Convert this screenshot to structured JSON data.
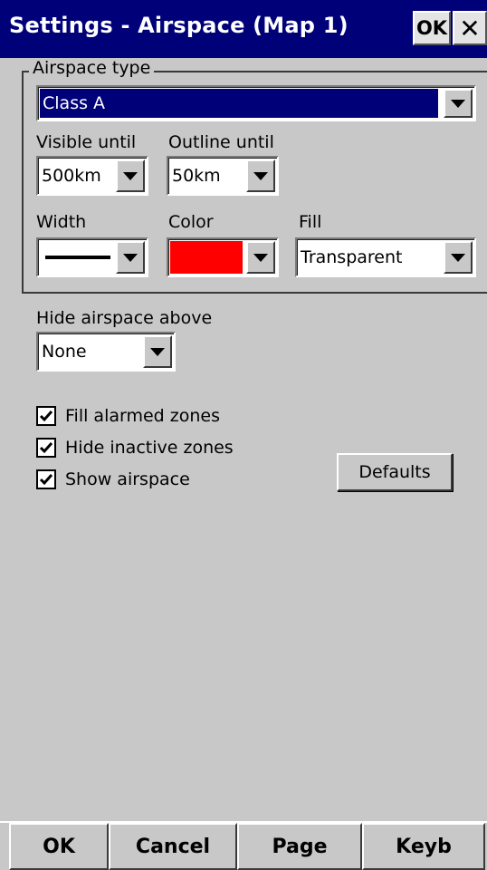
{
  "titlebar": {
    "title": "Settings - Airspace (Map 1)",
    "ok_label": "OK",
    "close_label": "✕"
  },
  "airspace_type": {
    "legend": "Airspace type",
    "selected": "Class A"
  },
  "visible_until": {
    "label": "Visible until",
    "value": "500km"
  },
  "outline_until": {
    "label": "Outline until",
    "value": "50km"
  },
  "width": {
    "label": "Width"
  },
  "color": {
    "label": "Color",
    "value_color": "#ff0000"
  },
  "fill": {
    "label": "Fill",
    "value": "Transparent"
  },
  "hide_above": {
    "label": "Hide airspace above",
    "value": "None"
  },
  "checkboxes": [
    {
      "label": "Fill alarmed zones",
      "checked": true
    },
    {
      "label": "Hide inactive zones",
      "checked": true
    },
    {
      "label": "Show airspace",
      "checked": true
    }
  ],
  "defaults_label": "Defaults",
  "bottombar": {
    "ok": "OK",
    "cancel": "Cancel",
    "page": "Page",
    "keyb": "Keyb"
  },
  "colors": {
    "titlebar": "#000078",
    "background": "#c8c8c8"
  }
}
